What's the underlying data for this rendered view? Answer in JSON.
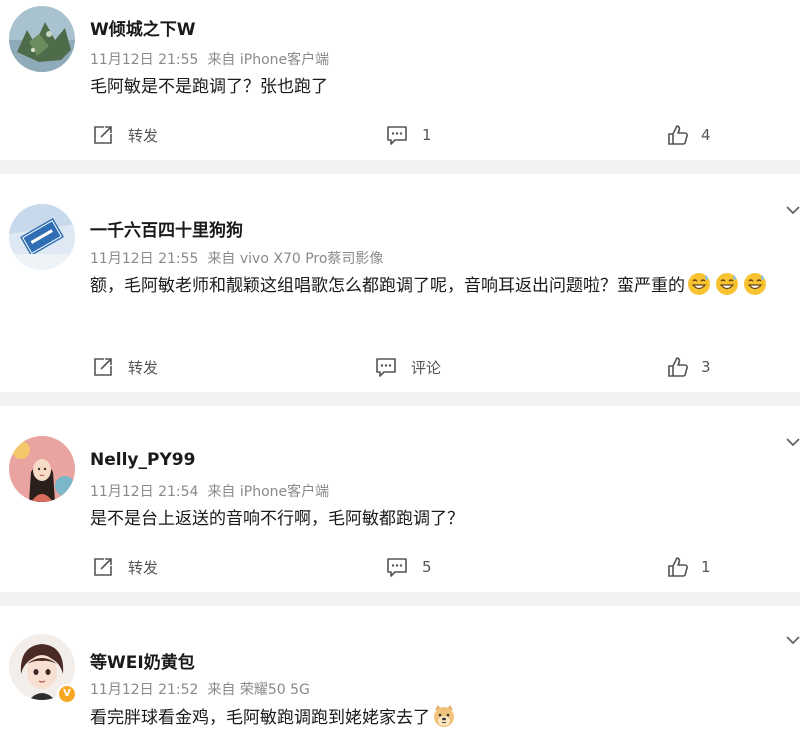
{
  "icons": {
    "repost": "share-out-icon",
    "comment": "speech-bubble-icon",
    "like": "thumbs-up-icon",
    "more": "chevron-down-icon",
    "emoji_grin": "sweat-grin-emoji",
    "emoji_doge": "doge-emoji",
    "verified": "verified-badge-icon"
  },
  "colors": {
    "divider": "#f2f2f2",
    "meta_text": "#8a8a8a",
    "badge": "#f5a623"
  },
  "posts": [
    {
      "username": "W倾城之下W",
      "date": "11月12日 21:55",
      "source": "来自 iPhone客户端",
      "text": "毛阿敏是不是跑调了？张也跑了",
      "repost_label": "转发",
      "comment_label": "1",
      "like_count": "4"
    },
    {
      "username": "一千六百四十里狗狗",
      "date": "11月12日 21:55",
      "source": "来自 vivo X70 Pro蔡司影像",
      "text": "额，毛阿敏老师和靓颖这组唱歌怎么都跑调了呢，音响耳返出问题啦？蛮严重的",
      "repost_label": "转发",
      "comment_label": "评论",
      "like_count": "3"
    },
    {
      "username": "Nelly_PY99",
      "date": "11月12日 21:54",
      "source": "来自 iPhone客户端",
      "text": "是不是台上返送的音响不行啊，毛阿敏都跑调了？",
      "repost_label": "转发",
      "comment_label": "5",
      "like_count": "1"
    },
    {
      "username": "等WEI奶黄包",
      "date": "11月12日 21:52",
      "source": "来自 荣耀50 5G",
      "text": "看完胖球看金鸡，毛阿敏跑调跑到姥姥家去了",
      "verified_mark": "V"
    }
  ]
}
